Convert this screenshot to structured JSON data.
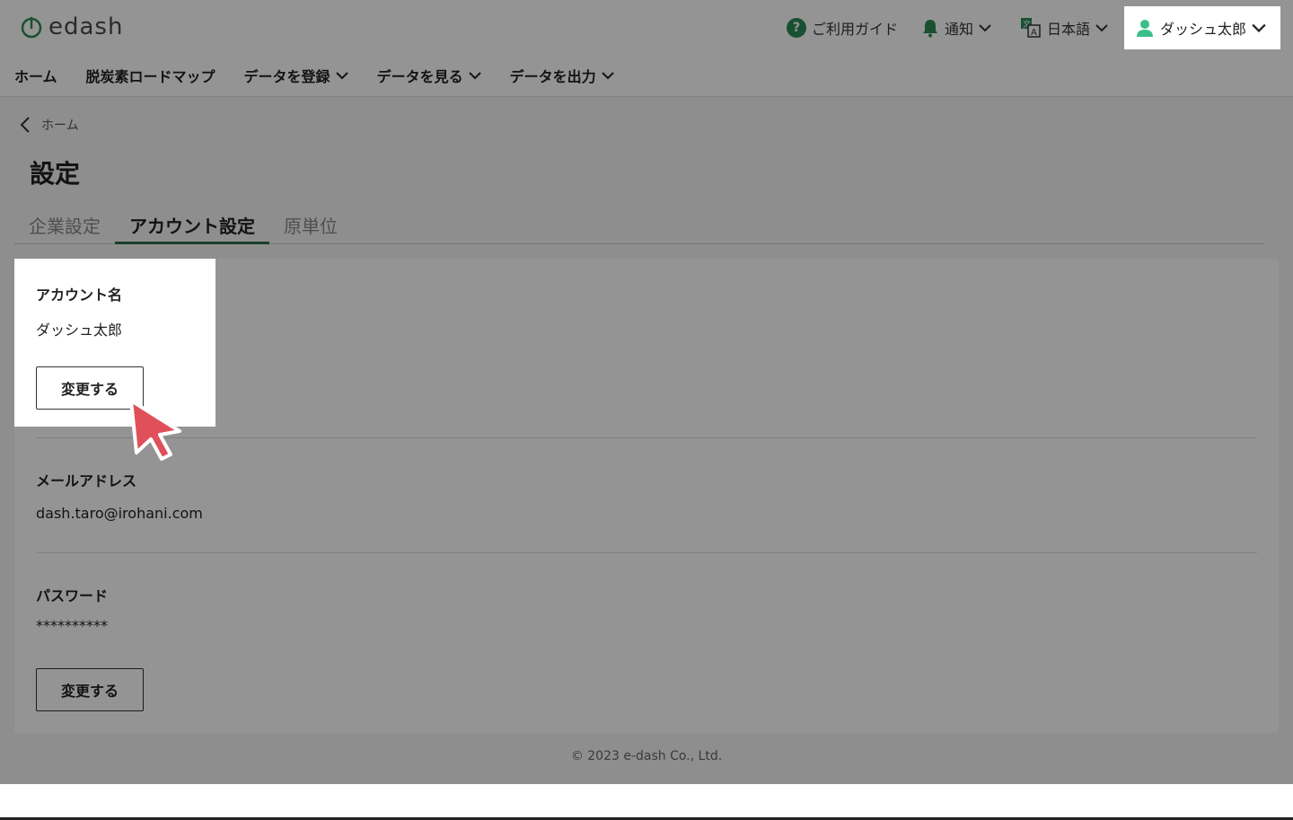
{
  "header": {
    "logo_text": "edash",
    "help_label": "ご利用ガイド",
    "notifications_label": "通知",
    "language_label": "日本語",
    "user_name": "ダッシュ太郎"
  },
  "nav": {
    "items": [
      {
        "label": "ホーム"
      },
      {
        "label": "脱炭素ロードマップ"
      },
      {
        "label": "データを登録"
      },
      {
        "label": "データを見る"
      },
      {
        "label": "データを出力"
      }
    ]
  },
  "breadcrumb": {
    "back_label": "ホーム"
  },
  "page": {
    "title": "設定"
  },
  "tabs": [
    {
      "label": "企業設定",
      "active": false
    },
    {
      "label": "アカウント設定",
      "active": true
    },
    {
      "label": "原単位",
      "active": false
    }
  ],
  "account": {
    "name_label": "アカウント名",
    "name_value": "ダッシュ太郎",
    "change_label": "変更する",
    "email_label": "メールアドレス",
    "email_value": "dash.taro@irohani.com",
    "password_label": "パスワード",
    "password_value": "**********",
    "password_change_label": "変更する"
  },
  "footer": {
    "copyright": "© 2023 e-dash Co., Ltd."
  },
  "colors": {
    "brand_green": "#2e8b57",
    "tab_underline": "#2e6b4a",
    "cursor_red": "#e0505a"
  }
}
